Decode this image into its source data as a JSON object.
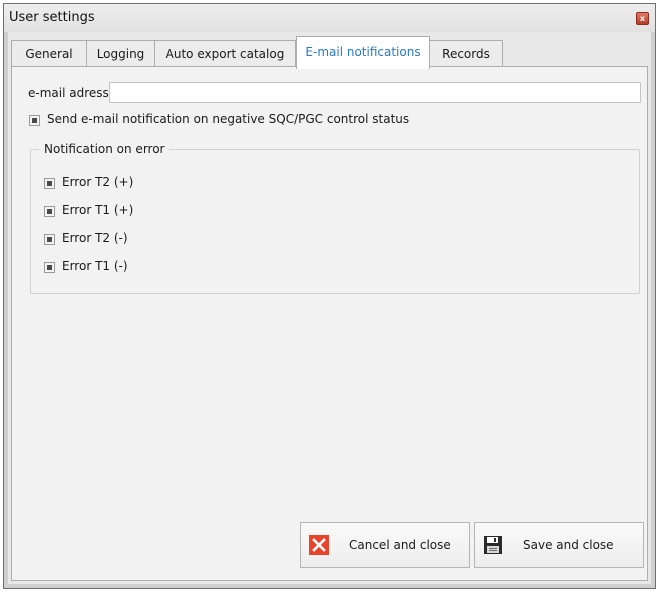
{
  "window": {
    "title": "User settings",
    "close_glyph": "x"
  },
  "tabs": [
    {
      "label": "General"
    },
    {
      "label": "Logging"
    },
    {
      "label": "Auto export catalog"
    },
    {
      "label": "E-mail notifications",
      "active": true
    },
    {
      "label": "Records"
    }
  ],
  "email": {
    "label": "e-mail adress",
    "value": ""
  },
  "send_notification": {
    "label": "Send e-mail notification on negative SQC/PGC control status",
    "state": "indeterminate"
  },
  "notification_group": {
    "title": "Notification on error",
    "options": [
      {
        "label": "Error T2 (+)",
        "state": "indeterminate"
      },
      {
        "label": "Error T1 (+)",
        "state": "indeterminate"
      },
      {
        "label": "Error T2 (-)",
        "state": "indeterminate"
      },
      {
        "label": "Error T1 (-)",
        "state": "indeterminate"
      }
    ]
  },
  "buttons": {
    "cancel": {
      "label": "Cancel and close",
      "icon": "close-x-icon",
      "icon_color": "#e8442c"
    },
    "save": {
      "label": "Save and close",
      "icon": "floppy-disk-icon"
    }
  },
  "colors": {
    "active_tab_text": "#2b78c6"
  }
}
